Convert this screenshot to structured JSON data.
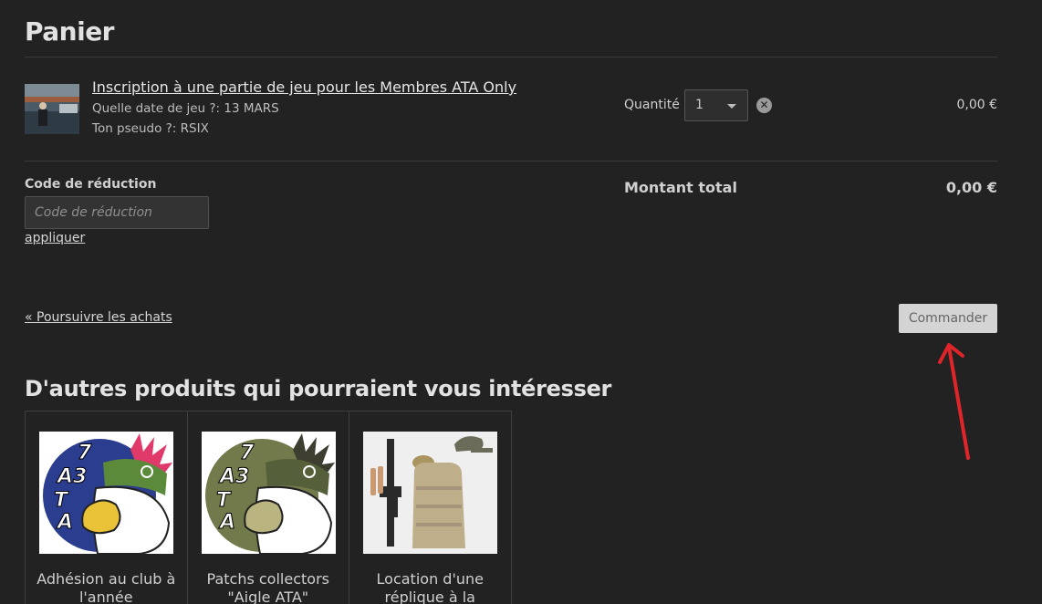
{
  "cart": {
    "title": "Panier",
    "item": {
      "name": "Inscription à une partie de jeu pour les Membres ATA Only",
      "options": [
        "Quelle date de jeu ?: 13 MARS",
        "Ton pseudo ?: RSIX"
      ],
      "quantity_label": "Quantité",
      "quantity_value": "1",
      "price": "0,00 €",
      "thumbnail_icon": "event-photo"
    },
    "coupon": {
      "label": "Code de réduction",
      "placeholder": "Code de réduction",
      "value": "",
      "apply_label": "appliquer"
    },
    "total": {
      "label": "Montant total",
      "value": "0,00 €"
    },
    "continue_label": "« Poursuivre les achats",
    "order_label": "Commander"
  },
  "related": {
    "title": "D'autres produits qui pourraient vous intéresser",
    "products": [
      {
        "name": "Adhésion au club à l'année",
        "icon": "ata-eagle-logo-blue"
      },
      {
        "name": "Patchs collectors \"Aigle ATA\"",
        "icon": "ata-eagle-logo-olive"
      },
      {
        "name": "Location d'une réplique à la",
        "icon": "rental-gear"
      }
    ]
  },
  "colors": {
    "background": "#222222",
    "arrow": "#e0252a",
    "logo_blue": "#2b3d8f",
    "logo_olive": "#727a4c",
    "logo_pink": "#e03a6b"
  }
}
